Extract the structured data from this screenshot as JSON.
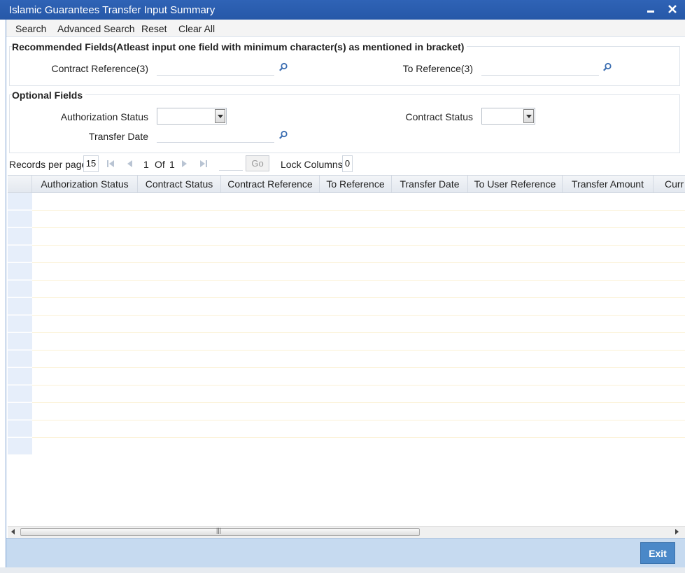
{
  "window": {
    "title": "Islamic Guarantees Transfer Input Summary",
    "minimize_icon": "minimize-icon",
    "close_icon": "close-icon"
  },
  "menu": {
    "items": [
      "Search",
      "Advanced Search",
      "Reset",
      "Clear All"
    ]
  },
  "recommended": {
    "legend": "Recommended Fields(Atleast input one field with minimum character(s) as mentioned in bracket)",
    "contract_reference_label": "Contract Reference(3)",
    "contract_reference_value": "",
    "to_reference_label": "To Reference(3)",
    "to_reference_value": "",
    "lookup_icon": "magnifier-icon"
  },
  "optional": {
    "legend": "Optional Fields",
    "authorization_status_label": "Authorization Status",
    "authorization_status_value": "",
    "contract_status_label": "Contract Status",
    "contract_status_value": "",
    "transfer_date_label": "Transfer Date",
    "transfer_date_value": ""
  },
  "pager": {
    "records_per_page_label": "Records per page",
    "records_per_page": "15",
    "current_page": "1",
    "of_label": "Of",
    "total_pages": "1",
    "goto_value": "",
    "go_label": "Go",
    "lock_columns_label": "Lock Columns",
    "lock_columns": "0"
  },
  "grid": {
    "columns": [
      "Authorization Status",
      "Contract Status",
      "Contract Reference",
      "To Reference",
      "Transfer Date",
      "To User Reference",
      "Transfer Amount",
      "Curr"
    ],
    "row_count": 15
  },
  "footer": {
    "exit_label": "Exit"
  },
  "colors": {
    "title_bar": "#2658a8",
    "footer": "#c6daf0",
    "exit_button": "#4a88c8"
  }
}
